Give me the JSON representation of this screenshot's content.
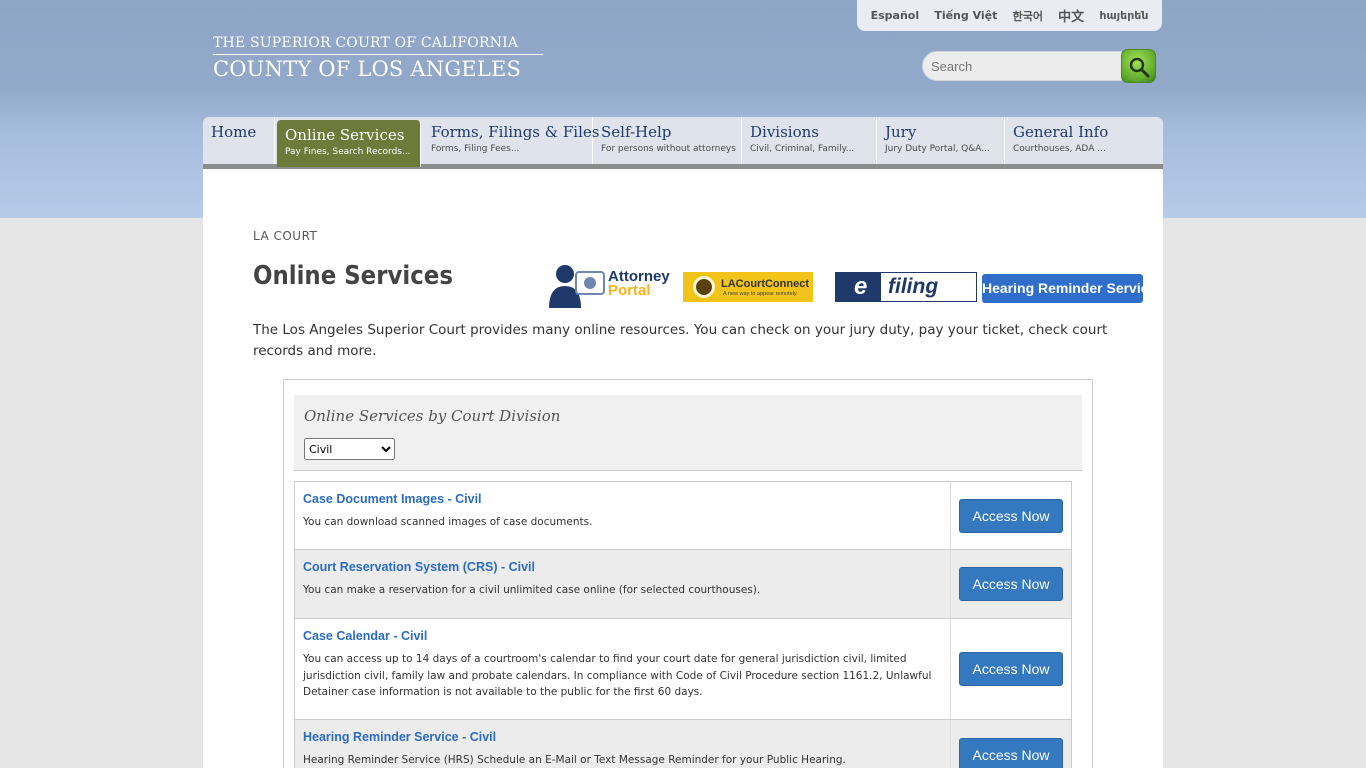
{
  "languages": [
    "Español",
    "Tiếng Việt",
    "한국어",
    "中文",
    "հայերեն"
  ],
  "logo": {
    "line1": "THE SUPERIOR COURT OF CALIFORNIA",
    "line2": "COUNTY OF LOS ANGELES"
  },
  "search": {
    "placeholder": "Search"
  },
  "nav": [
    {
      "title": "Home",
      "sub": ""
    },
    {
      "title": "Online Services",
      "sub": "Pay Fines, Search Records..."
    },
    {
      "title": "Forms, Filings & Files",
      "sub": "Forms, Filing Fees..."
    },
    {
      "title": "Self-Help",
      "sub": "For persons without attorneys"
    },
    {
      "title": "Divisions",
      "sub": "Civil, Criminal, Family..."
    },
    {
      "title": "Jury",
      "sub": "Jury Duty Portal, Q&A..."
    },
    {
      "title": "General Info",
      "sub": "Courthouses, ADA ..."
    }
  ],
  "breadcrumb": "LA COURT",
  "page_title": "Online Services",
  "intro": "The Los Angeles Superior Court provides many online resources. You can check on your jury duty, pay your ticket, check court records and more.",
  "badges": {
    "attorney_a": "Attorney",
    "attorney_p": "Portal",
    "lacc_name": "LACourtConnect",
    "lacc_tag": "A new way to appear remotely.",
    "efile_e": "e",
    "efile_f": "filing",
    "hrs": "Hearing Reminder Service"
  },
  "division": {
    "heading": "Online Services by Court Division",
    "selected": "Civil"
  },
  "services": [
    {
      "title": "Case Document Images - Civil",
      "desc": "You can download scanned images of case documents.",
      "button": "Access Now"
    },
    {
      "title": "Court Reservation System (CRS) - Civil",
      "desc": "You can make a reservation for a civil unlimited case online (for selected courthouses).",
      "button": "Access Now"
    },
    {
      "title": "Case Calendar - Civil",
      "desc": "You can access up to 14 days of a courtroom's calendar to find your court date for general jurisdiction civil, limited jurisdiction civil, family law and probate calendars. In compliance with Code of Civil Procedure section 1161.2, Unlawful Detainer case information is not available to the public for the first 60 days.",
      "button": "Access Now"
    },
    {
      "title": "Hearing Reminder Service - Civil",
      "desc": "Hearing Reminder Service (HRS) Schedule an E-Mail or Text Message Reminder for your Public Hearing.",
      "button": "Access Now"
    }
  ],
  "colors": {
    "nav_active": "#6d7a3a",
    "link": "#2b6cc4",
    "button": "#3479c0"
  }
}
